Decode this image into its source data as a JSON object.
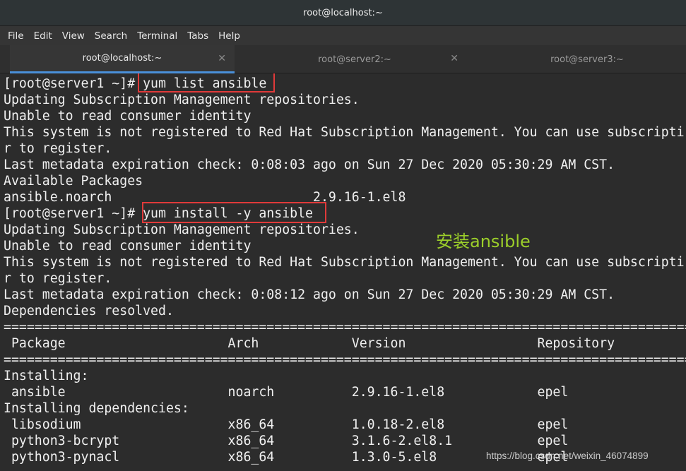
{
  "window": {
    "title": "root@localhost:~"
  },
  "menu": [
    "File",
    "Edit",
    "View",
    "Search",
    "Terminal",
    "Tabs",
    "Help"
  ],
  "tabs": [
    {
      "label": "root@localhost:~",
      "active": true
    },
    {
      "label": "root@server2:~",
      "active": false
    },
    {
      "label": "root@server3:~",
      "active": false
    }
  ],
  "terminal": {
    "lines": [
      "[root@server1 ~]# yum list ansible",
      "Updating Subscription Management repositories.",
      "Unable to read consumer identity",
      "This system is not registered to Red Hat Subscription Management. You can use subscripti",
      "r to register.",
      "Last metadata expiration check: 0:08:03 ago on Sun 27 Dec 2020 05:30:29 AM CST.",
      "Available Packages",
      "ansible.noarch                          2.9.16-1.el8",
      "[root@server1 ~]# yum install -y ansible",
      "Updating Subscription Management repositories.",
      "Unable to read consumer identity",
      "This system is not registered to Red Hat Subscription Management. You can use subscripti",
      "r to register.",
      "Last metadata expiration check: 0:08:12 ago on Sun 27 Dec 2020 05:30:29 AM CST.",
      "Dependencies resolved.",
      "==========================================================================================",
      " Package                     Arch            Version                 Repository",
      "==========================================================================================",
      "Installing:",
      " ansible                     noarch          2.9.16-1.el8            epel",
      "Installing dependencies:",
      " libsodium                   x86_64          1.0.18-2.el8            epel",
      " python3-bcrypt              x86_64          3.1.6-2.el8.1           epel",
      " python3-pynacl              x86_64          1.3.0-5.el8             epel"
    ]
  },
  "annotation": "安装ansible",
  "watermark": "https://blog.csdn.net/weixin_46074899",
  "colors": {
    "highlight_box": "#e03a3a",
    "annotation": "#9ccf2a",
    "active_tab_underline": "#4a90d9"
  }
}
